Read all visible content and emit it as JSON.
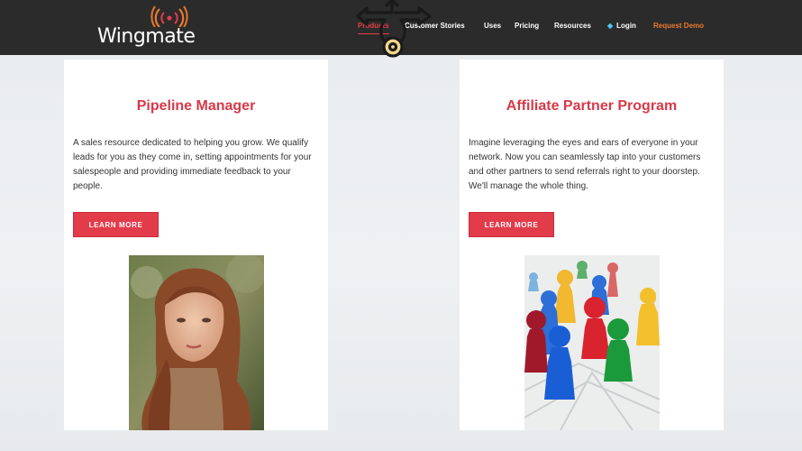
{
  "header": {
    "logo_text": "Wingmate",
    "nav": [
      {
        "label": "Products",
        "active": true
      },
      {
        "label": "Customer Stories"
      },
      {
        "label": "Uses"
      },
      {
        "label": "Pricing"
      },
      {
        "label": "Resources"
      },
      {
        "label": "Login",
        "icon": "diamond-icon"
      },
      {
        "label": "Request Demo"
      }
    ]
  },
  "cards": [
    {
      "title": "Pipeline Manager",
      "description": "A sales resource dedicated to helping you grow. We qualify leads for you as they come in, setting appointments for your salespeople and providing immediate feedback to your people.",
      "button": "LEARN MORE",
      "image": "woman-portrait-photo"
    },
    {
      "title": "Affiliate Partner Program",
      "description": "Imagine leveraging the eyes and ears of everyone in your network. Now you can seamlessly tap into your customers and other partners to send referrals right to your doorstep. We'll manage the whole thing.",
      "button": "LEARN MORE",
      "image": "game-pawns-photo"
    }
  ],
  "colors": {
    "accent": "#e23b4a",
    "title": "#d6394a",
    "header_bg": "#2b2b2b",
    "demo": "#ea7a2e"
  }
}
